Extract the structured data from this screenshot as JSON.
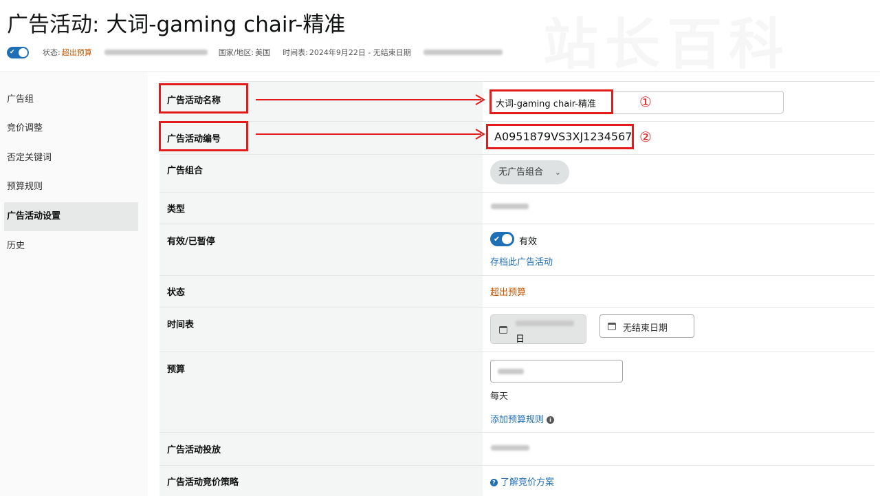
{
  "header": {
    "title_label": "广告活动:",
    "title_name": "大词-gaming chair-精准"
  },
  "meta": {
    "status_label": "状态:",
    "status_value": "超出预算",
    "country_label": "国家/地区:",
    "country_value": "美国",
    "schedule_label": "时间表:",
    "schedule_value": "2024年9月22日 - 无结束日期"
  },
  "sidebar": {
    "items": [
      {
        "label": "广告组"
      },
      {
        "label": "竞价调整"
      },
      {
        "label": "否定关键词"
      },
      {
        "label": "预算规则"
      },
      {
        "label": "广告活动设置"
      },
      {
        "label": "历史"
      }
    ]
  },
  "settings": {
    "campaign_name_label": "广告活动名称",
    "campaign_name_value": "大词-gaming chair-精准",
    "campaign_id_label": "广告活动编号",
    "campaign_id_value": "A0951879VS3XJ1234567",
    "portfolio_label": "广告组合",
    "portfolio_value": "无广告组合",
    "type_label": "类型",
    "active_label": "有效/已暂停",
    "active_value": "有效",
    "archive_link": "存档此广告活动",
    "status_label": "状态",
    "status_value": "超出预算",
    "schedule_label": "时间表",
    "schedule_start_suffix": "日",
    "schedule_end": "无结束日期",
    "budget_label": "预算",
    "budget_period": "每天",
    "add_budget_rule": "添加预算规则",
    "delivery_label": "广告活动投放",
    "bidding_label": "广告活动竞价策略",
    "bidding_link": "了解竞价方案"
  },
  "annotations": {
    "marker_1": "①",
    "marker_2": "②"
  },
  "colors": {
    "accent_blue": "#1f6fb7",
    "warn_orange": "#c45500",
    "annotation_red": "#e31b1b"
  }
}
